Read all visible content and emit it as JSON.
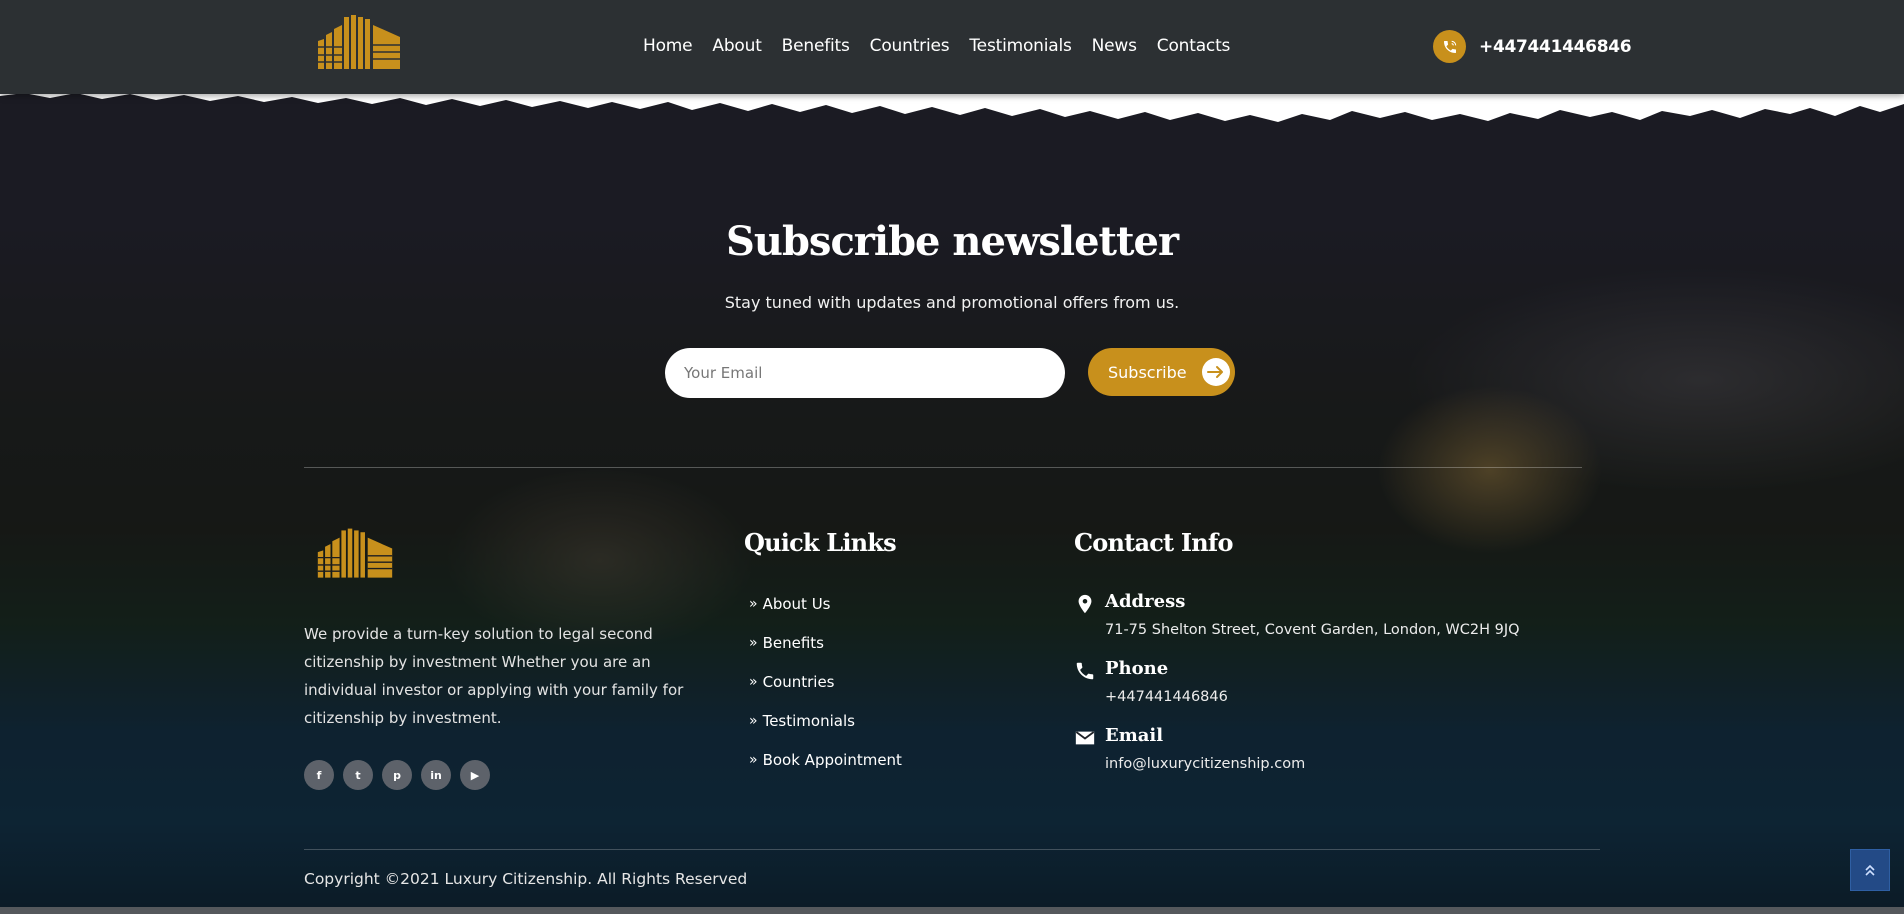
{
  "header": {
    "nav": [
      {
        "label": "Home"
      },
      {
        "label": "About"
      },
      {
        "label": "Benefits"
      },
      {
        "label": "Countries"
      },
      {
        "label": "Testimonials"
      },
      {
        "label": "News"
      },
      {
        "label": "Contacts"
      }
    ],
    "phone": "+447441446846",
    "phone_icon": "phone-ring-icon"
  },
  "newsletter": {
    "title": "Subscribe newsletter",
    "subtitle": "Stay tuned with updates and promotional offers from us.",
    "email_placeholder": "Your Email",
    "email_value": "",
    "button_label": "Subscribe"
  },
  "footer": {
    "about_text": "We provide a turn-key solution to legal second citizenship by investment Whether you are an individual investor or applying with your family for citizenship by investment.",
    "socials": [
      {
        "name": "facebook-icon",
        "glyph": "f"
      },
      {
        "name": "twitter-icon",
        "glyph": "t"
      },
      {
        "name": "pinterest-icon",
        "glyph": "p"
      },
      {
        "name": "linkedin-icon",
        "glyph": "in"
      },
      {
        "name": "youtube-icon",
        "glyph": "▶"
      }
    ],
    "quick_links": {
      "title": "Quick Links",
      "items": [
        "About Us",
        "Benefits",
        "Countries",
        "Testimonials",
        "Book Appointment"
      ]
    },
    "contact_info": {
      "title": "Contact Info",
      "address_label": "Address",
      "address_value": "71-75 Shelton Street, Covent Garden, London, WC2H 9JQ",
      "phone_label": "Phone",
      "phone_value": "+447441446846",
      "email_label": "Email",
      "email_value": "info@luxurycitizenship.com"
    },
    "copyright": "Copyright ©2021 Luxury Citizenship. All Rights Reserved"
  },
  "colors": {
    "accent": "#c8901c",
    "header_bg": "#2c3033",
    "to_top_bg": "#234a86"
  }
}
